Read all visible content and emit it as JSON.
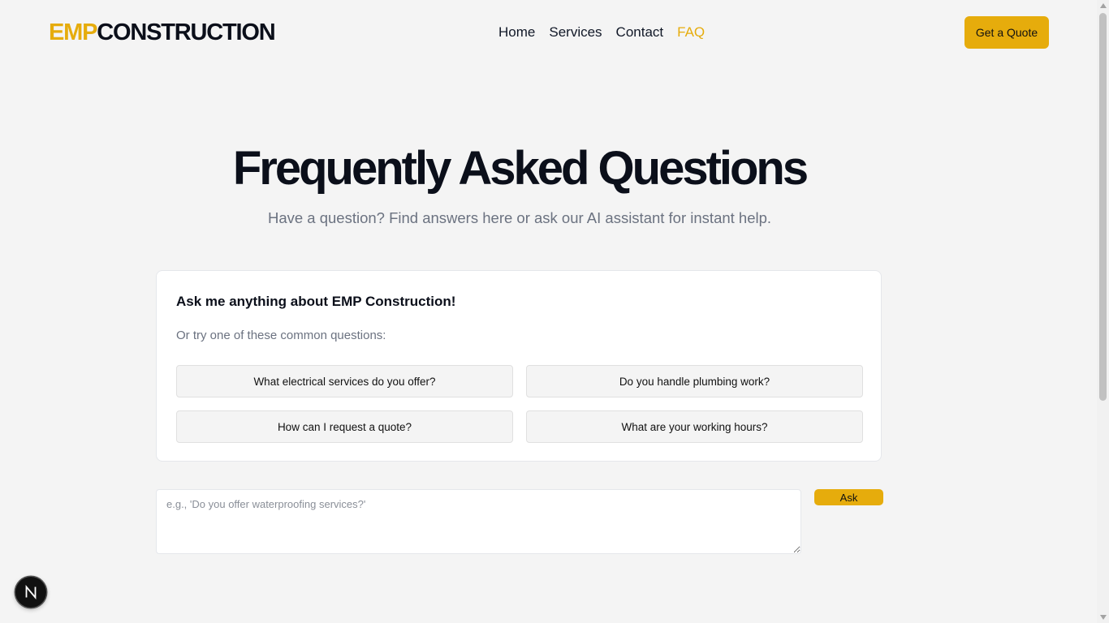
{
  "header": {
    "logo": {
      "part1": "EMP",
      "part2": "CONSTRUCTION"
    },
    "nav": [
      {
        "label": "Home",
        "active": false
      },
      {
        "label": "Services",
        "active": false
      },
      {
        "label": "Contact",
        "active": false
      },
      {
        "label": "FAQ",
        "active": true
      }
    ],
    "quote_button": "Get a Quote"
  },
  "hero": {
    "title": "Frequently Asked Questions",
    "subtitle": "Have a question? Find answers here or ask our AI assistant for instant help."
  },
  "assistant": {
    "title": "Ask me anything about EMP Construction!",
    "prompt": "Or try one of these common questions:",
    "questions": [
      "What electrical services do you offer?",
      "Do you handle plumbing work?",
      "How can I request a quote?",
      "What are your working hours?"
    ]
  },
  "ask_form": {
    "placeholder": "e.g., 'Do you offer waterproofing services?'",
    "value": "",
    "button": "Ask"
  },
  "dev_badge": {
    "icon": "nextjs-icon"
  },
  "colors": {
    "accent": "#e6ac0c",
    "background": "#f4f4f4",
    "heading": "#0b0f1a",
    "muted": "#6b7280"
  }
}
